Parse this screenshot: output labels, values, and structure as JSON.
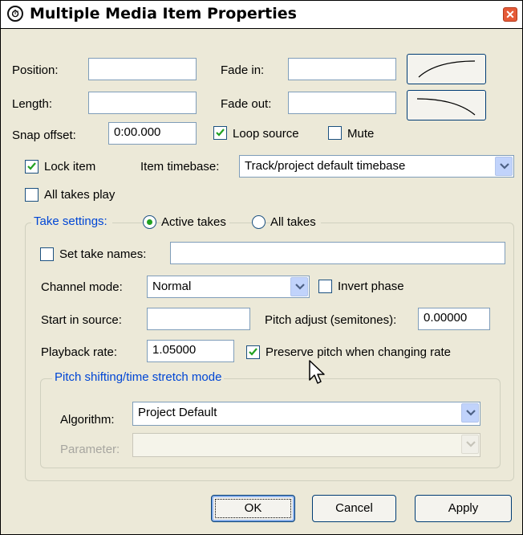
{
  "window": {
    "title": "Multiple Media Item Properties"
  },
  "fields": {
    "position_label": "Position:",
    "position_value": "",
    "length_label": "Length:",
    "length_value": "",
    "fade_in_label": "Fade in:",
    "fade_in_value": "",
    "fade_out_label": "Fade out:",
    "fade_out_value": "",
    "snap_offset_label": "Snap offset:",
    "snap_offset_value": "0:00.000",
    "loop_source_label": "Loop source",
    "loop_source_checked": true,
    "mute_label": "Mute",
    "mute_checked": false,
    "lock_item_label": "Lock item",
    "lock_item_checked": true,
    "item_timebase_label": "Item timebase:",
    "item_timebase_value": "Track/project default timebase",
    "all_takes_play_label": "All takes play",
    "all_takes_play_checked": false
  },
  "take_settings": {
    "group_label": "Take settings:",
    "active_takes_label": "Active takes",
    "all_takes_label": "All takes",
    "selected_option": "Active takes",
    "set_take_names_label": "Set take names:",
    "set_take_names_checked": false,
    "take_names_value": "",
    "channel_mode_label": "Channel mode:",
    "channel_mode_value": "Normal",
    "invert_phase_label": "Invert phase",
    "invert_phase_checked": false,
    "start_in_source_label": "Start in source:",
    "start_in_source_value": "",
    "pitch_adjust_label": "Pitch adjust (semitones):",
    "pitch_adjust_value": "0.00000",
    "playback_rate_label": "Playback rate:",
    "playback_rate_value": "1.05000",
    "preserve_pitch_label": "Preserve pitch when changing rate",
    "preserve_pitch_checked": true
  },
  "pitch_shift": {
    "group_label": "Pitch shifting/time stretch mode",
    "algorithm_label": "Algorithm:",
    "algorithm_value": "Project Default",
    "parameter_label": "Parameter:",
    "parameter_value": ""
  },
  "buttons": {
    "ok": "OK",
    "cancel": "Cancel",
    "apply": "Apply"
  },
  "colors": {
    "group_label": "#0046d5",
    "checkmark": "#21a121",
    "dialog_bg": "#ece9d8",
    "close_button": "#e55a37"
  }
}
